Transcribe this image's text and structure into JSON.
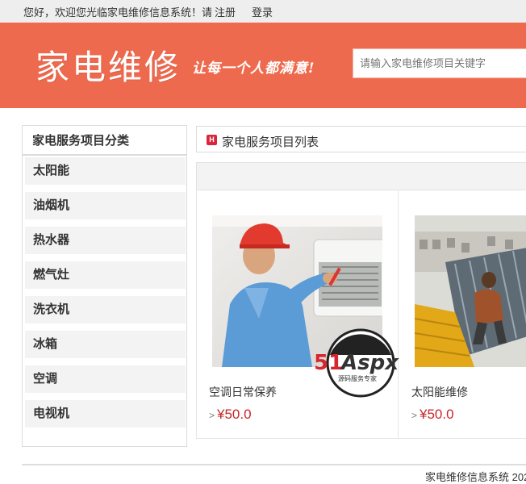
{
  "topbar": {
    "welcome": "您好，欢迎您光临家电维修信息系统！请",
    "register": "注册",
    "login": "登录"
  },
  "banner": {
    "logo": "家电维修",
    "slogan": "让每一个人都满意!",
    "search_placeholder": "请输入家电维修项目关键字",
    "color": "#ee6a4e"
  },
  "sidebar": {
    "title": "家电服务项目分类",
    "items": [
      "太阳能",
      "油烟机",
      "热水器",
      "燃气灶",
      "洗衣机",
      "冰箱",
      "空调",
      "电视机"
    ]
  },
  "main": {
    "badge": "H",
    "title": "家电服务项目列表",
    "products": [
      {
        "name": "空调日常保养",
        "price": "¥50.0",
        "arrow": ">"
      },
      {
        "name": "太阳能维修",
        "price": "¥50.0",
        "arrow": ">"
      }
    ]
  },
  "watermark": {
    "logo": "51Aspx",
    "tagline": "源码服务专家"
  },
  "footer": {
    "text": "家电维修信息系统 202"
  }
}
